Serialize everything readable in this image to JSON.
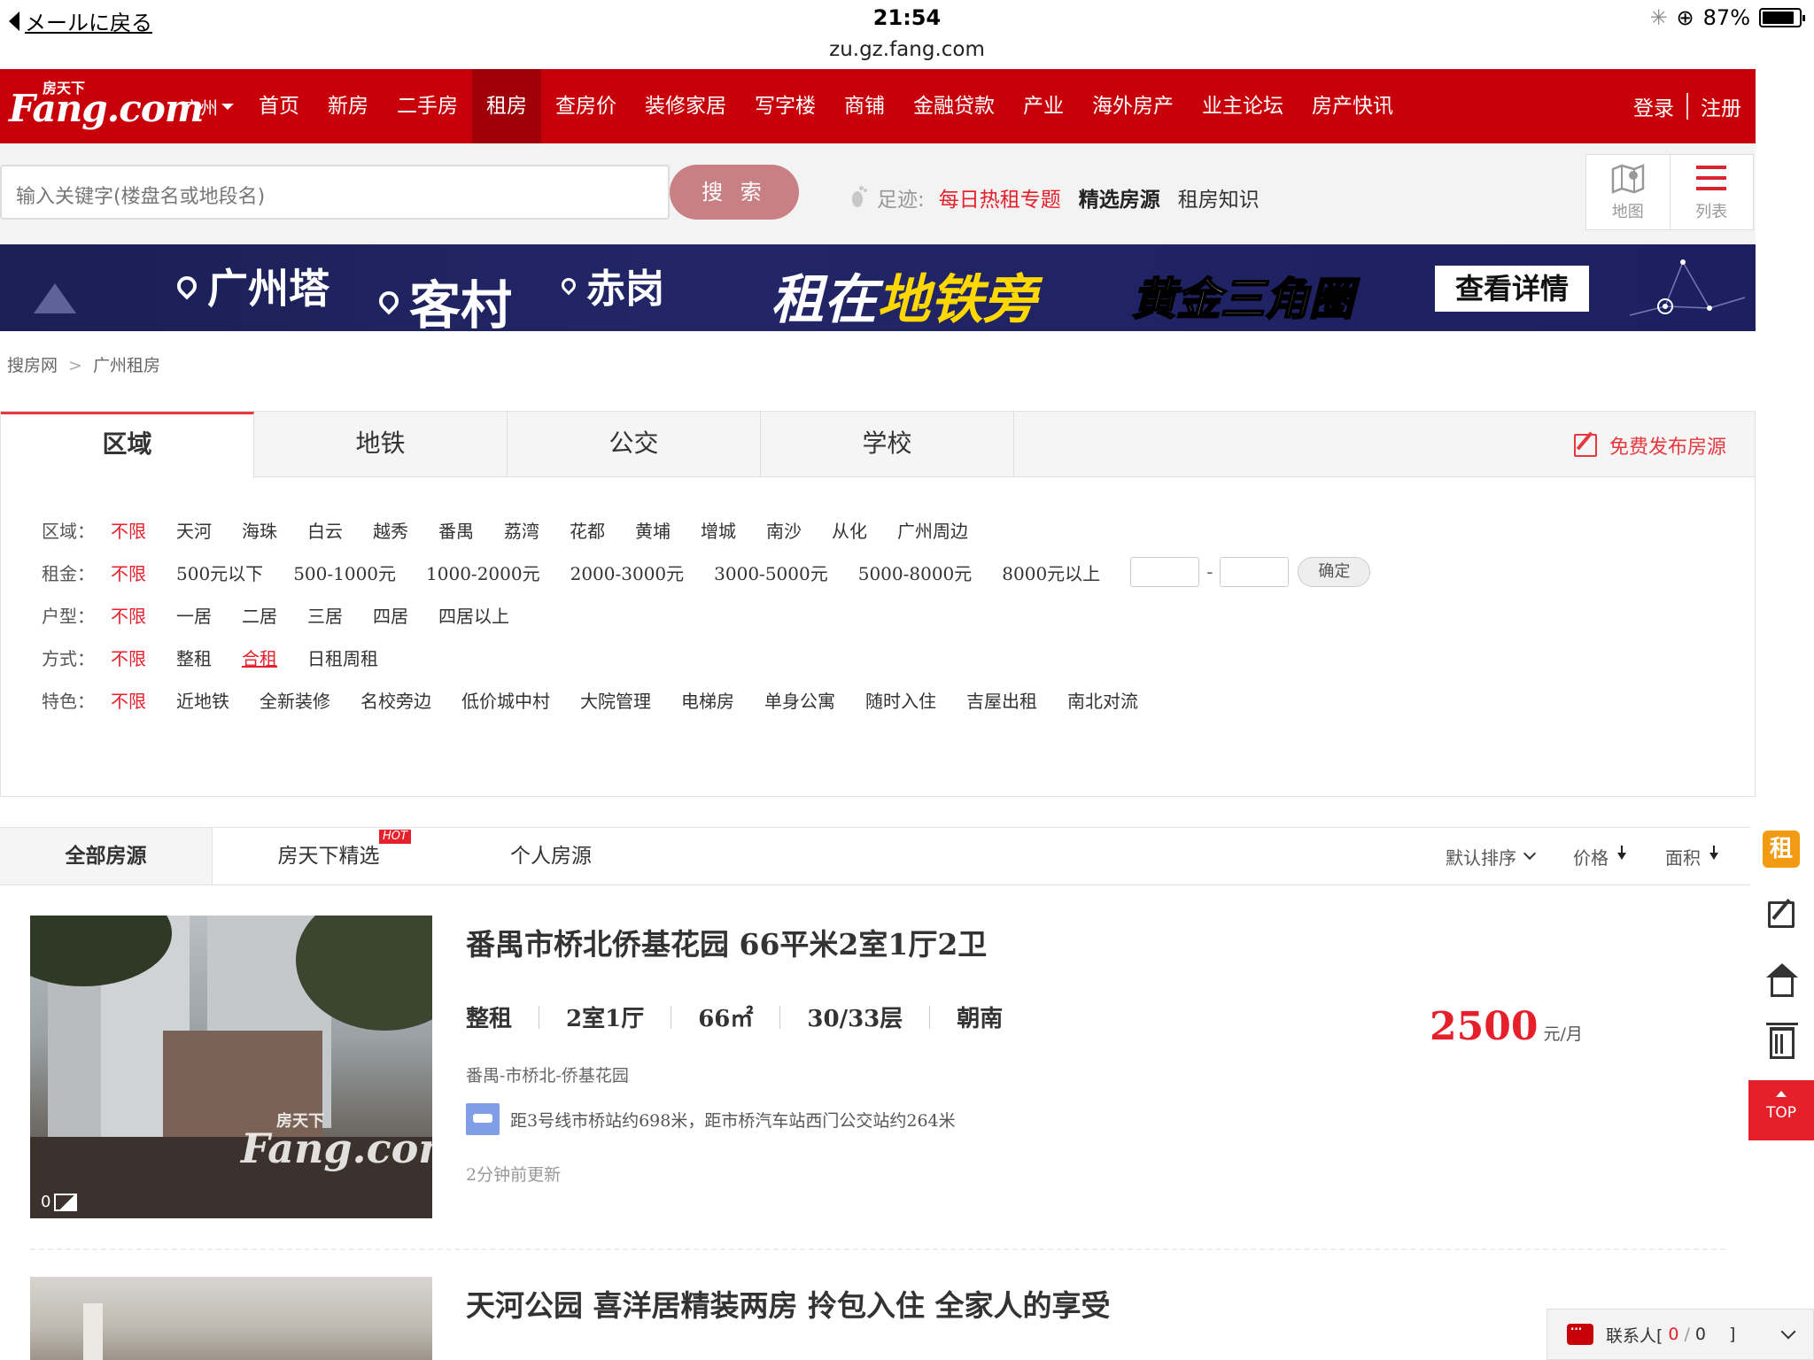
{
  "status_bar": {
    "back_label": "メールに戻る",
    "time": "21:54",
    "battery": "87%",
    "battery_level": 0.87,
    "url": "zu.gz.fang.com"
  },
  "nav": {
    "logo_small": "房天下",
    "logo_text": "Fang.com",
    "city": "广州",
    "items": [
      "首页",
      "新房",
      "二手房",
      "租房",
      "查房价",
      "装修家居",
      "写字楼",
      "商铺",
      "金融贷款",
      "产业",
      "海外房产",
      "业主论坛",
      "房产快讯"
    ],
    "active_item": "租房",
    "login": "登录",
    "register": "注册"
  },
  "search": {
    "placeholder": "输入关键字(楼盘名或地段名)",
    "button": "搜 索",
    "footprint_label": "足迹:",
    "links": [
      {
        "label": "每日热租专题",
        "color": "#e5202a"
      },
      {
        "label": "精选房源",
        "color": "#222222",
        "bold": true
      },
      {
        "label": "租房知识",
        "color": "#333333"
      }
    ],
    "map_label": "地图",
    "list_label": "列表"
  },
  "banner": {
    "locations": [
      "广州塔",
      "客村",
      "赤岗"
    ],
    "slogan_a": "租在",
    "slogan_b": "地铁旁",
    "slogan_c": "黄金三角圈",
    "detail_button": "查看详情"
  },
  "breadcrumb": {
    "home": "搜房网",
    "sep": ">",
    "current": "广州租房"
  },
  "filter": {
    "tabs": [
      "区域",
      "地铁",
      "公交",
      "学校"
    ],
    "active_tab": "区域",
    "publish": "免费发布房源",
    "rows": [
      {
        "label": "区域：",
        "options": [
          "不限",
          "天河",
          "海珠",
          "白云",
          "越秀",
          "番禺",
          "荔湾",
          "花都",
          "黄埔",
          "增城",
          "南沙",
          "从化",
          "广州周边"
        ]
      },
      {
        "label": "租金：",
        "options": [
          "不限",
          "500元以下",
          "500-1000元",
          "1000-2000元",
          "2000-3000元",
          "3000-5000元",
          "5000-8000元",
          "8000元以上"
        ],
        "confirm": "确定",
        "range_sep": "-"
      },
      {
        "label": "户型：",
        "options": [
          "不限",
          "一居",
          "二居",
          "三居",
          "四居",
          "四居以上"
        ]
      },
      {
        "label": "方式：",
        "options": [
          "不限",
          "整租",
          "合租",
          "日租周租"
        ]
      },
      {
        "label": "特色：",
        "options": [
          "不限",
          "近地铁",
          "全新装修",
          "名校旁边",
          "低价城中村",
          "大院管理",
          "电梯房",
          "单身公寓",
          "随时入住",
          "吉屋出租",
          "南北对流"
        ]
      }
    ]
  },
  "list_tabs": {
    "tabs": [
      "全部房源",
      "房天下精选",
      "个人房源"
    ],
    "hot_badge": "HOT",
    "sorts": [
      "默认排序",
      "价格",
      "面积"
    ]
  },
  "listings": [
    {
      "title": "番禺市桥北侨基花园 66平米2室1厅2卫",
      "attrs": [
        "整租",
        "2室1厅",
        "66㎡",
        "30/33层",
        "朝南"
      ],
      "address": "番禺-市桥北-侨基花园",
      "transit": "距3号线市桥站约698米，距市桥汽车站西门公交站约264米",
      "updated": "2分钟前更新",
      "price": "2500",
      "unit": "元/月",
      "photo_count": "0",
      "watermark_small": "房天下",
      "watermark": "Fang.com"
    },
    {
      "title": "天河公园 喜洋居精装两房 拎包入住 全家人的享受"
    }
  ],
  "sidebar": {
    "zu": "租",
    "top": "TOP"
  },
  "contact": {
    "label": "联系人[",
    "count": "0",
    "slash": "/",
    "total": "0",
    "close": "]"
  },
  "colors": {
    "brand_red": "#c8000a",
    "accent_red": "#e5202a",
    "banner_navy": "#222667",
    "gold": "#ffd800"
  }
}
